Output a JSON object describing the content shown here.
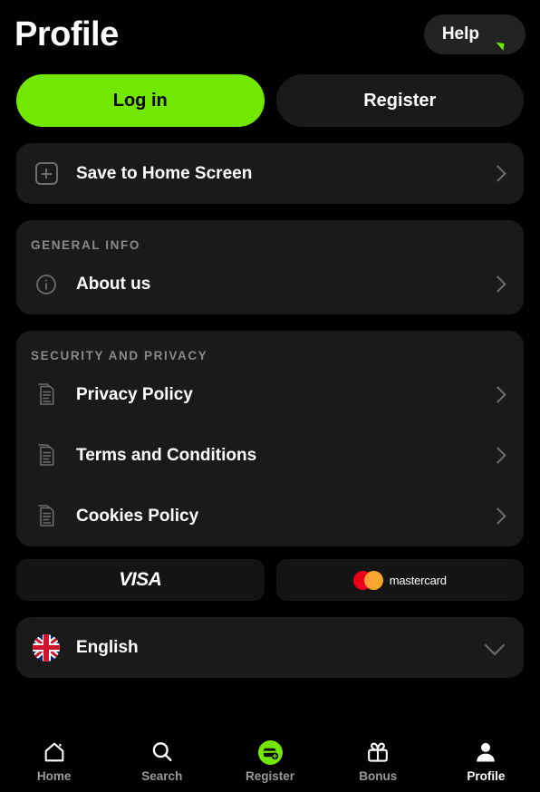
{
  "header": {
    "title": "Profile",
    "help_label": "Help",
    "help_icon": "chat-bubble-icon"
  },
  "auth": {
    "login_label": "Log in",
    "register_label": "Register"
  },
  "save_row": {
    "label": "Save to Home Screen",
    "icon": "add-to-home-icon",
    "chevron": "chevron-right-icon"
  },
  "general_info": {
    "section_title": "GENERAL INFO",
    "items": [
      {
        "label": "About us",
        "icon": "info-circle-icon"
      }
    ]
  },
  "security_privacy": {
    "section_title": "SECURITY AND PRIVACY",
    "items": [
      {
        "label": "Privacy Policy",
        "icon": "document-icon"
      },
      {
        "label": "Terms and Conditions",
        "icon": "document-icon"
      },
      {
        "label": "Cookies Policy",
        "icon": "document-icon"
      }
    ]
  },
  "payments": [
    {
      "name": "visa",
      "label": "VISA"
    },
    {
      "name": "mastercard",
      "label": "mastercard"
    }
  ],
  "language": {
    "label": "English",
    "flag": "uk-flag-icon",
    "chevron": "chevron-down-icon"
  },
  "bottom_nav": {
    "items": [
      {
        "label": "Home",
        "icon": "home-icon",
        "active": false
      },
      {
        "label": "Search",
        "icon": "search-icon",
        "active": false
      },
      {
        "label": "Register",
        "icon": "register-card-icon",
        "active": false
      },
      {
        "label": "Bonus",
        "icon": "gift-icon",
        "active": false
      },
      {
        "label": "Profile",
        "icon": "person-icon",
        "active": true
      }
    ]
  },
  "colors": {
    "accent_green": "#72E800",
    "page_bg": "#000000",
    "card_bg": "#1A1A1A",
    "muted_text": "#8A8A8A",
    "chevron": "#6E6E6E",
    "mc_red": "#EB001B",
    "mc_yellow": "#F79E1B"
  }
}
